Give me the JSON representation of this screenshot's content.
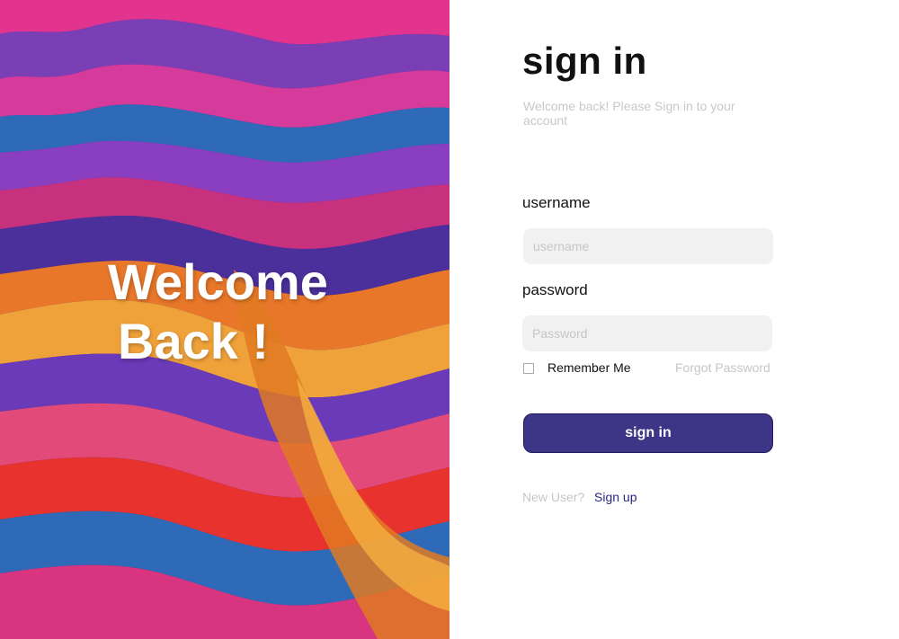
{
  "hero": {
    "line1": "Welcome",
    "line2": "Back !"
  },
  "form": {
    "title": "sign in",
    "subtitle": "Welcome back! Please Sign in to your account",
    "username_label": "username",
    "username_placeholder": "username",
    "password_label": "password",
    "password_placeholder": "Password",
    "remember_label": "Remember Me",
    "forgot_label": "Forgot Password",
    "submit_label": "sign in",
    "new_user_text": "New User?",
    "signup_label": "Sign up"
  },
  "colors": {
    "primary_button": "#3d3687",
    "link": "#2a2780",
    "muted_text": "#c6c6ca",
    "input_bg": "#f1f1f2"
  }
}
